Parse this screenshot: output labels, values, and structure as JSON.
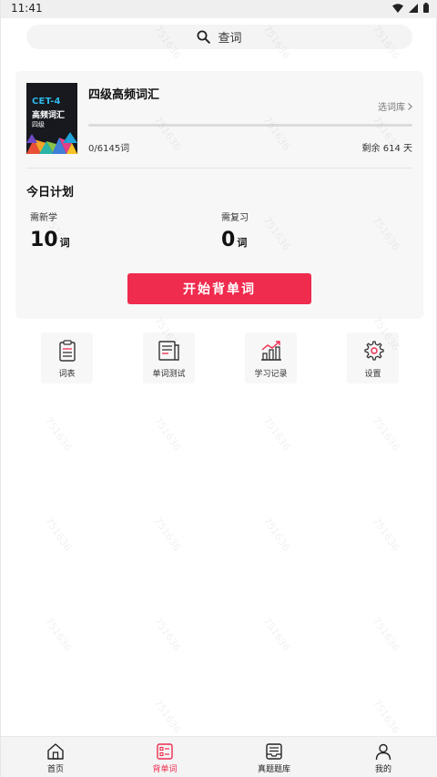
{
  "status_bar": {
    "time": "11:41"
  },
  "search": {
    "placeholder": "查词"
  },
  "book": {
    "cover_badge": "CET-4",
    "cover_title": "高频词汇",
    "cover_level": "四级",
    "title": "四级高频词汇",
    "switch_label": "选词库",
    "progress_text": "0/6145词",
    "progress_fraction": 0,
    "remaining_text": "剩余 614 天"
  },
  "plan": {
    "title": "今日计划",
    "new_label": "需新学",
    "new_count": "10",
    "new_unit": "词",
    "review_label": "需复习",
    "review_count": "0",
    "review_unit": "词",
    "start_button": "开始背单词"
  },
  "tools": [
    {
      "label": "词表",
      "icon": "word-list-icon"
    },
    {
      "label": "单词测试",
      "icon": "test-icon"
    },
    {
      "label": "学习记录",
      "icon": "chart-icon"
    },
    {
      "label": "设置",
      "icon": "gear-icon"
    }
  ],
  "nav": [
    {
      "label": "首页",
      "icon": "home-icon"
    },
    {
      "label": "背单词",
      "icon": "flashcard-icon",
      "active": true
    },
    {
      "label": "真题题库",
      "icon": "question-bank-icon"
    },
    {
      "label": "我的",
      "icon": "user-icon"
    }
  ],
  "watermark": "751636",
  "colors": {
    "accent": "#ef2b4e",
    "card_bg": "#f7f7f7",
    "cover_bg": "#17191f",
    "cover_accent": "#2fb7e8"
  }
}
